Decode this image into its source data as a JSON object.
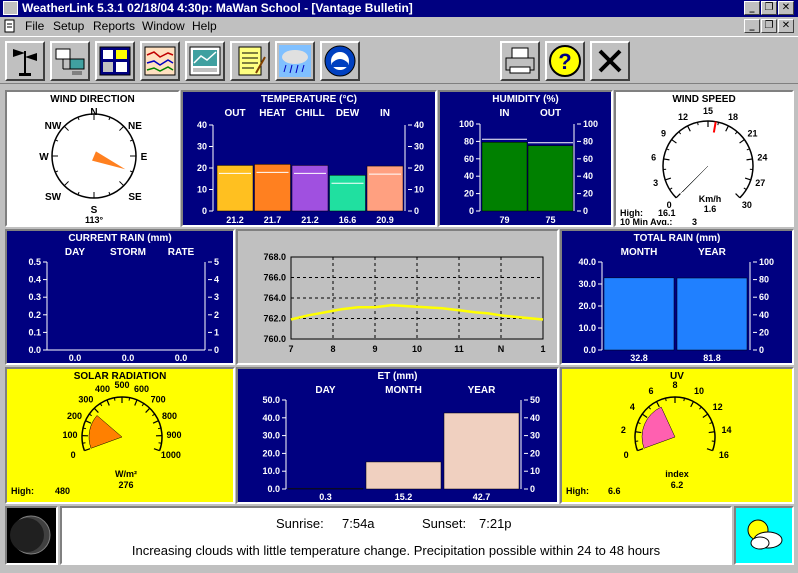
{
  "window": {
    "title": "WeatherLink 5.3.1  02/18/04   4:30p: MaWan School - [Vantage Bulletin]"
  },
  "menu": {
    "file": "File",
    "setup": "Setup",
    "reports": "Reports",
    "window": "Window",
    "help": "Help"
  },
  "wind_direction": {
    "title": "WIND DIRECTION",
    "n": "N",
    "ne": "NE",
    "e": "E",
    "se": "SE",
    "s": "S",
    "sw": "SW",
    "w": "W",
    "nw": "NW",
    "degrees": "113°",
    "value_deg": 113
  },
  "temperature": {
    "title": "TEMPERATURE  (°C)",
    "labels": [
      "OUT",
      "HEAT",
      "CHILL",
      "DEW",
      "IN"
    ],
    "values": [
      "21.2",
      "21.7",
      "21.2",
      "16.6",
      "20.9"
    ],
    "nums": [
      21.2,
      21.7,
      21.2,
      16.6,
      20.9
    ],
    "ticks": [
      "40",
      "30",
      "20",
      "10",
      "0"
    ],
    "colors": [
      "#ffc020",
      "#ff8020",
      "#a050e0",
      "#20e0a0",
      "#ffa080"
    ]
  },
  "humidity": {
    "title": "HUMIDITY  (%)",
    "labels": [
      "IN",
      "OUT"
    ],
    "values": [
      "79",
      "75"
    ],
    "nums": [
      79,
      75
    ],
    "ticks": [
      "100",
      "80",
      "60",
      "40",
      "20",
      "0"
    ]
  },
  "wind_speed": {
    "title": "WIND SPEED",
    "ticks": [
      "0",
      "3",
      "6",
      "9",
      "12",
      "15",
      "18",
      "21",
      "24",
      "27",
      "30"
    ],
    "unit": "Km/h",
    "current": "1.6",
    "current_num": 1.6,
    "high_label": "High:",
    "high": "16.1",
    "avg_label": "10 Min Avg.:",
    "avg": "3"
  },
  "current_rain": {
    "title": "CURRENT RAIN  (mm)",
    "labels": [
      "DAY",
      "STORM",
      "RATE"
    ],
    "values": [
      "0.0",
      "0.0",
      "0.0"
    ],
    "left_ticks": [
      "0.5",
      "0.4",
      "0.3",
      "0.2",
      "0.1",
      "0.0"
    ],
    "right_ticks": [
      "5",
      "4",
      "3",
      "2",
      "1",
      "0"
    ]
  },
  "barometer": {
    "y_ticks": [
      "768.0",
      "766.0",
      "764.0",
      "762.0",
      "760.0"
    ],
    "x_ticks": [
      "7",
      "8",
      "9",
      "10",
      "11",
      "N",
      "1"
    ]
  },
  "total_rain": {
    "title": "TOTAL RAIN  (mm)",
    "labels": [
      "MONTH",
      "YEAR"
    ],
    "values": [
      "32.8",
      "81.8"
    ],
    "nums": [
      32.8,
      81.8
    ],
    "left_ticks": [
      "40.0",
      "30.0",
      "20.0",
      "10.0",
      "0.0"
    ],
    "right_ticks": [
      "100",
      "80",
      "60",
      "40",
      "20",
      "0"
    ]
  },
  "solar": {
    "title": "SOLAR RADIATION",
    "ticks": [
      "0",
      "100",
      "200",
      "300",
      "400",
      "500",
      "600",
      "700",
      "800",
      "900",
      "1000"
    ],
    "unit": "W/m²",
    "current": "276",
    "current_num": 276,
    "high_label": "High:",
    "high": "480"
  },
  "et": {
    "title": "ET  (mm)",
    "labels": [
      "DAY",
      "MONTH",
      "YEAR"
    ],
    "values": [
      "0.3",
      "15.2",
      "42.7"
    ],
    "nums": [
      0.3,
      15.2,
      42.7
    ],
    "left_ticks": [
      "50.0",
      "40.0",
      "30.0",
      "20.0",
      "10.0",
      "0.0"
    ],
    "right_ticks": [
      "50",
      "40",
      "30",
      "20",
      "10",
      "0"
    ]
  },
  "uv": {
    "title": "UV",
    "ticks": [
      "0",
      "2",
      "4",
      "6",
      "8",
      "10",
      "12",
      "14",
      "16"
    ],
    "unit": "index",
    "current": "6.2",
    "current_num": 6.2,
    "high_label": "High:",
    "high": "6.6"
  },
  "forecast": {
    "sunrise_label": "Sunrise:",
    "sunrise": "7:54a",
    "sunset_label": "Sunset:",
    "sunset": "7:21p",
    "text": "Increasing clouds with little temperature change.  Precipitation possible within 24 to 48 hours"
  }
}
